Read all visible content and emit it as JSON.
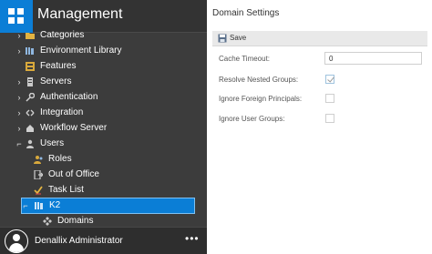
{
  "sidebar": {
    "title": "Management",
    "items": [
      {
        "label": "Categories",
        "chevron": "›",
        "icon": "folder-icon"
      },
      {
        "label": "Environment Library",
        "chevron": "›",
        "icon": "library-icon"
      },
      {
        "label": "Features",
        "chevron": "",
        "icon": "features-icon"
      },
      {
        "label": "Servers",
        "chevron": "›",
        "icon": "server-icon"
      },
      {
        "label": "Authentication",
        "chevron": "›",
        "icon": "key-icon"
      },
      {
        "label": "Integration",
        "chevron": "›",
        "icon": "integration-icon"
      },
      {
        "label": "Workflow Server",
        "chevron": "›",
        "icon": "workflow-icon"
      },
      {
        "label": "Users",
        "chevron": "⌐",
        "icon": "users-icon"
      }
    ],
    "user_children": [
      {
        "label": "Roles",
        "icon": "roles-icon"
      },
      {
        "label": "Out of Office",
        "icon": "out-of-office-icon"
      },
      {
        "label": "Task List",
        "icon": "task-list-icon"
      }
    ],
    "selected": {
      "label": "K2",
      "icon": "k2-icon"
    },
    "domains": {
      "label": "Domains",
      "icon": "domains-icon"
    },
    "user": {
      "name": "Denallix Administrator",
      "more": "•••"
    }
  },
  "main": {
    "title": "Domain Settings",
    "toolbar": {
      "save_label": "Save"
    },
    "fields": {
      "cache_timeout_label": "Cache Timeout:",
      "cache_timeout_value": "0",
      "resolve_nested_label": "Resolve Nested Groups:",
      "resolve_nested_checked": true,
      "ignore_foreign_label": "Ignore Foreign Principals:",
      "ignore_foreign_checked": false,
      "ignore_user_groups_label": "Ignore User Groups:",
      "ignore_user_groups_checked": false
    }
  },
  "colors": {
    "accent": "#0b7ed6",
    "sidebar_bg": "#3c3c3c",
    "toolbar_bg": "#e9e9e9"
  }
}
